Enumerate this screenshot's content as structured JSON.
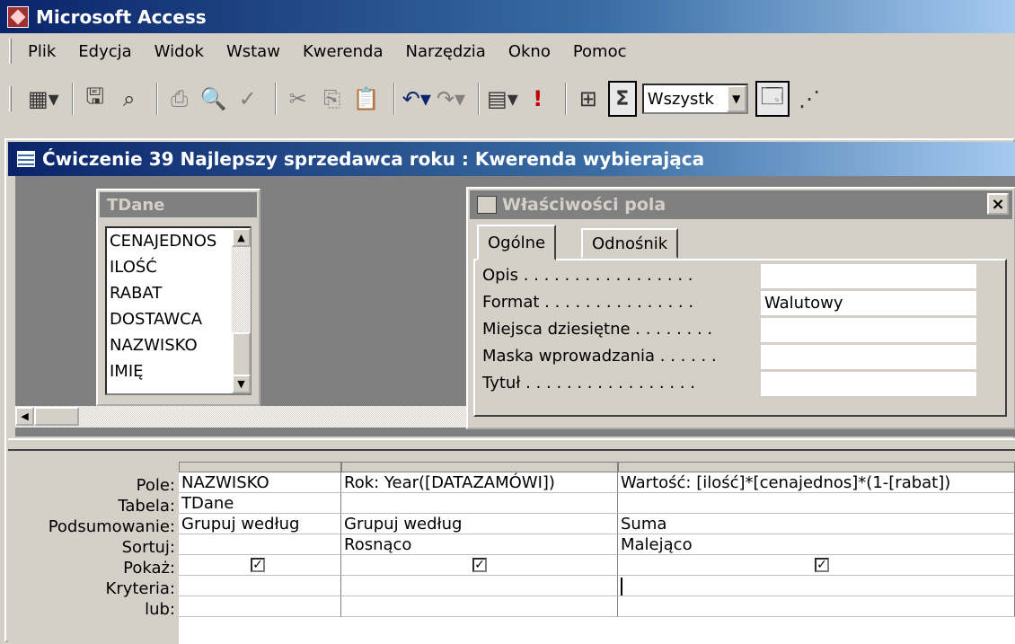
{
  "app": {
    "title": "Microsoft Access"
  },
  "menu": {
    "items": [
      "Plik",
      "Edycja",
      "Widok",
      "Wstaw",
      "Kwerenda",
      "Narzędzia",
      "Okno",
      "Pomoc"
    ]
  },
  "toolbar": {
    "sigma": "Σ",
    "combo_value": "Wszystk"
  },
  "query_window": {
    "title": "Ćwiczenie 39 Najlepszy sprzedawca roku : Kwerenda wybierająca"
  },
  "table_box": {
    "title": "TDane",
    "fields": [
      "CENAJEDNOS",
      "ILOŚĆ",
      "RABAT",
      "DOSTAWCA",
      "NAZWISKO",
      "IMIĘ"
    ]
  },
  "properties": {
    "title": "Właściwości pola",
    "close": "×",
    "tabs": [
      "Ogólne",
      "Odnośnik"
    ],
    "rows": [
      {
        "label": "Opis . . . . . . . . . . . . . . . . .",
        "value": ""
      },
      {
        "label": "Format . . . . . . . . . . . . . . .",
        "value": "Walutowy"
      },
      {
        "label": "Miejsca dziesiętne . . . . . . . .",
        "value": ""
      },
      {
        "label": "Maska wprowadzania . . . . . .",
        "value": ""
      },
      {
        "label": "Tytuł . . . . . . . . . . . . . . . . .",
        "value": ""
      }
    ]
  },
  "grid": {
    "row_labels": [
      "Pole:",
      "Tabela:",
      "Podsumowanie:",
      "Sortuj:",
      "Pokaż:",
      "Kryteria:",
      "lub:"
    ],
    "columns": [
      {
        "pole": "NAZWISKO",
        "tabela": "TDane",
        "podsumowanie": "Grupuj według",
        "sortuj": "",
        "pokaz": true,
        "kryteria": "",
        "lub": ""
      },
      {
        "pole": "Rok: Year([DATAZAMÓWI])",
        "tabela": "",
        "podsumowanie": "Grupuj według",
        "sortuj": "Rosnąco",
        "pokaz": true,
        "kryteria": "",
        "lub": ""
      },
      {
        "pole": "Wartość: [ilość]*[cenajednos]*(1-[rabat])",
        "tabela": "",
        "podsumowanie": "Suma",
        "sortuj": "Malejąco",
        "pokaz": true,
        "kryteria": "",
        "lub": ""
      }
    ]
  }
}
